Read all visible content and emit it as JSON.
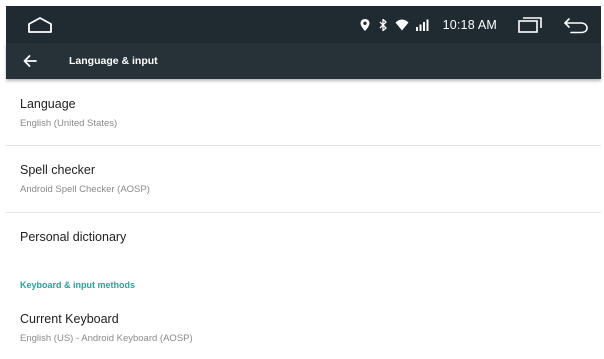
{
  "status_bar": {
    "time": "10:18 AM",
    "icons": [
      "location-icon",
      "bluetooth-icon",
      "wifi-icon",
      "signal-icon"
    ]
  },
  "navigation": {
    "home_icon": "home-icon",
    "recents_icon": "recents-icon",
    "back_icon": "back-icon"
  },
  "app_bar": {
    "title": "Language & input",
    "back_icon": "arrow-left-icon"
  },
  "settings": {
    "language": {
      "title": "Language",
      "summary": "English (United States)"
    },
    "spell_checker": {
      "title": "Spell checker",
      "summary": "Android Spell Checker (AOSP)"
    },
    "personal_dictionary": {
      "title": "Personal dictionary"
    },
    "keyboard_section": {
      "header": "Keyboard & input methods"
    },
    "current_keyboard": {
      "title": "Current Keyboard",
      "summary": "English (US) - Android Keyboard (AOSP)"
    }
  },
  "colors": {
    "status_bar_bg": "#1f2b31",
    "app_bar_bg": "#263238",
    "accent": "#26a69a"
  }
}
